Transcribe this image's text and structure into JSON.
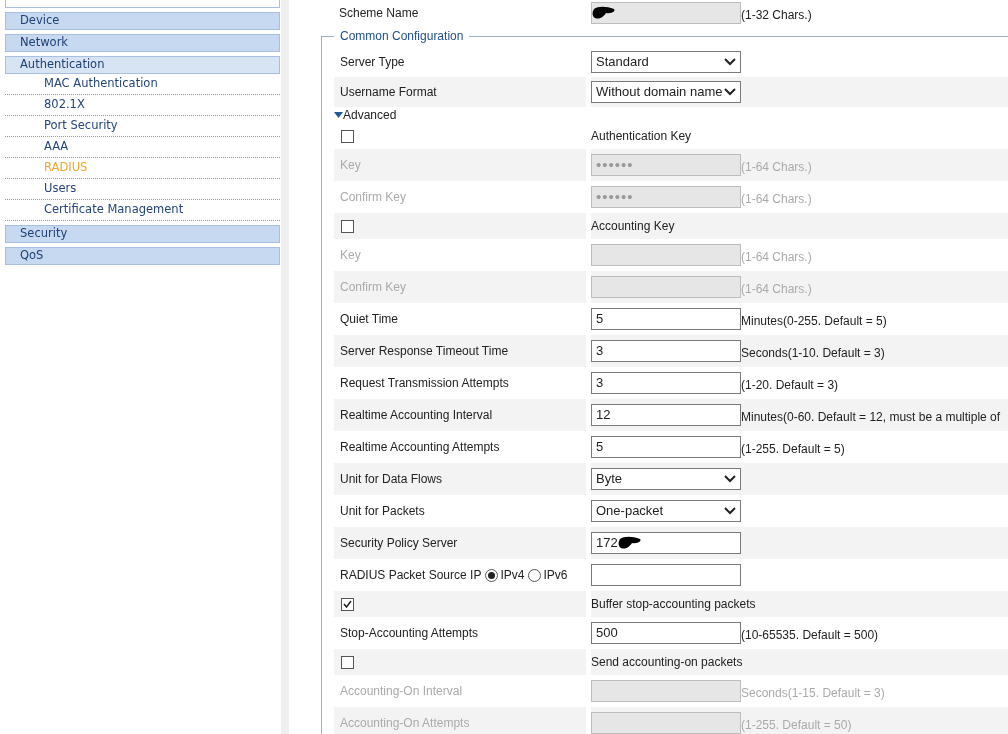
{
  "sidebar": {
    "groups": [
      {
        "label": "Device",
        "expanded": false
      },
      {
        "label": "Network",
        "expanded": false
      },
      {
        "label": "Authentication",
        "expanded": true,
        "children": [
          {
            "label": "MAC Authentication",
            "selected": false
          },
          {
            "label": "802.1X",
            "selected": false
          },
          {
            "label": "Port Security",
            "selected": false
          },
          {
            "label": "AAA",
            "selected": false
          },
          {
            "label": "RADIUS",
            "selected": true
          },
          {
            "label": "Users",
            "selected": false
          },
          {
            "label": "Certificate Management",
            "selected": false
          }
        ]
      },
      {
        "label": "Security",
        "expanded": false
      },
      {
        "label": "QoS",
        "expanded": false
      }
    ]
  },
  "scheme_name": {
    "label": "Scheme Name",
    "redacted": true,
    "hint": "(1-32 Chars.)"
  },
  "common_configuration": {
    "legend": "Common Configuration",
    "basic_rows": [
      {
        "kind": "select",
        "label": "Server Type",
        "value": "Standard"
      },
      {
        "kind": "select",
        "label": "Username Format",
        "value": "Without domain name"
      }
    ],
    "advanced": {
      "label": "Advanced",
      "expanded": true
    },
    "rows": [
      {
        "kind": "checkbox",
        "label": "Authentication Key",
        "checked": false
      },
      {
        "kind": "input",
        "label": "Key",
        "value": "••••••",
        "hint": "(1-64 Chars.)",
        "disabled": true
      },
      {
        "kind": "input",
        "label": "Confirm Key",
        "value": "••••••",
        "hint": "(1-64 Chars.)",
        "disabled": true
      },
      {
        "kind": "checkbox",
        "label": "Accounting Key",
        "checked": false
      },
      {
        "kind": "input",
        "label": "Key",
        "hint": "(1-64 Chars.)",
        "disabled": true
      },
      {
        "kind": "input",
        "label": "Confirm Key",
        "hint": "(1-64 Chars.)",
        "disabled": true
      },
      {
        "kind": "input",
        "label": "Quiet Time",
        "value": "5",
        "hint": "Minutes(0-255. Default = 5)",
        "disabled": false
      },
      {
        "kind": "input",
        "label": "Server Response Timeout Time",
        "value": "3",
        "hint": "Seconds(1-10. Default = 3)",
        "disabled": false
      },
      {
        "kind": "input",
        "label": "Request Transmission Attempts",
        "value": "3",
        "hint": "(1-20. Default = 3)",
        "disabled": false
      },
      {
        "kind": "input",
        "label": "Realtime Accounting Interval",
        "value": "12",
        "hint": "Minutes(0-60. Default = 12, must be a multiple of",
        "disabled": false
      },
      {
        "kind": "input",
        "label": "Realtime Accounting Attempts",
        "value": "5",
        "hint": "(1-255. Default = 5)",
        "disabled": false
      },
      {
        "kind": "select",
        "label": "Unit for Data Flows",
        "value": "Byte"
      },
      {
        "kind": "select",
        "label": "Unit for Packets",
        "value": "One-packet"
      },
      {
        "kind": "redacted-input",
        "label": "Security Policy Server",
        "value": "172"
      },
      {
        "kind": "radio",
        "label": "RADIUS Packet Source IP",
        "options": [
          {
            "label": "IPv4",
            "selected": true
          },
          {
            "label": "IPv6",
            "selected": false
          }
        ]
      },
      {
        "kind": "checkbox",
        "label": "Buffer stop-accounting packets",
        "checked": true
      },
      {
        "kind": "input",
        "label": "Stop-Accounting Attempts",
        "value": "500",
        "hint": "(10-65535. Default = 500)",
        "disabled": false
      },
      {
        "kind": "checkbox",
        "label": "Send accounting-on packets",
        "checked": false
      },
      {
        "kind": "input",
        "label": "Accounting-On Interval",
        "hint": "Seconds(1-15. Default = 3)",
        "disabled": true
      },
      {
        "kind": "input",
        "label": "Accounting-On Attempts",
        "hint": "(1-255. Default = 50)",
        "disabled": true
      }
    ]
  }
}
